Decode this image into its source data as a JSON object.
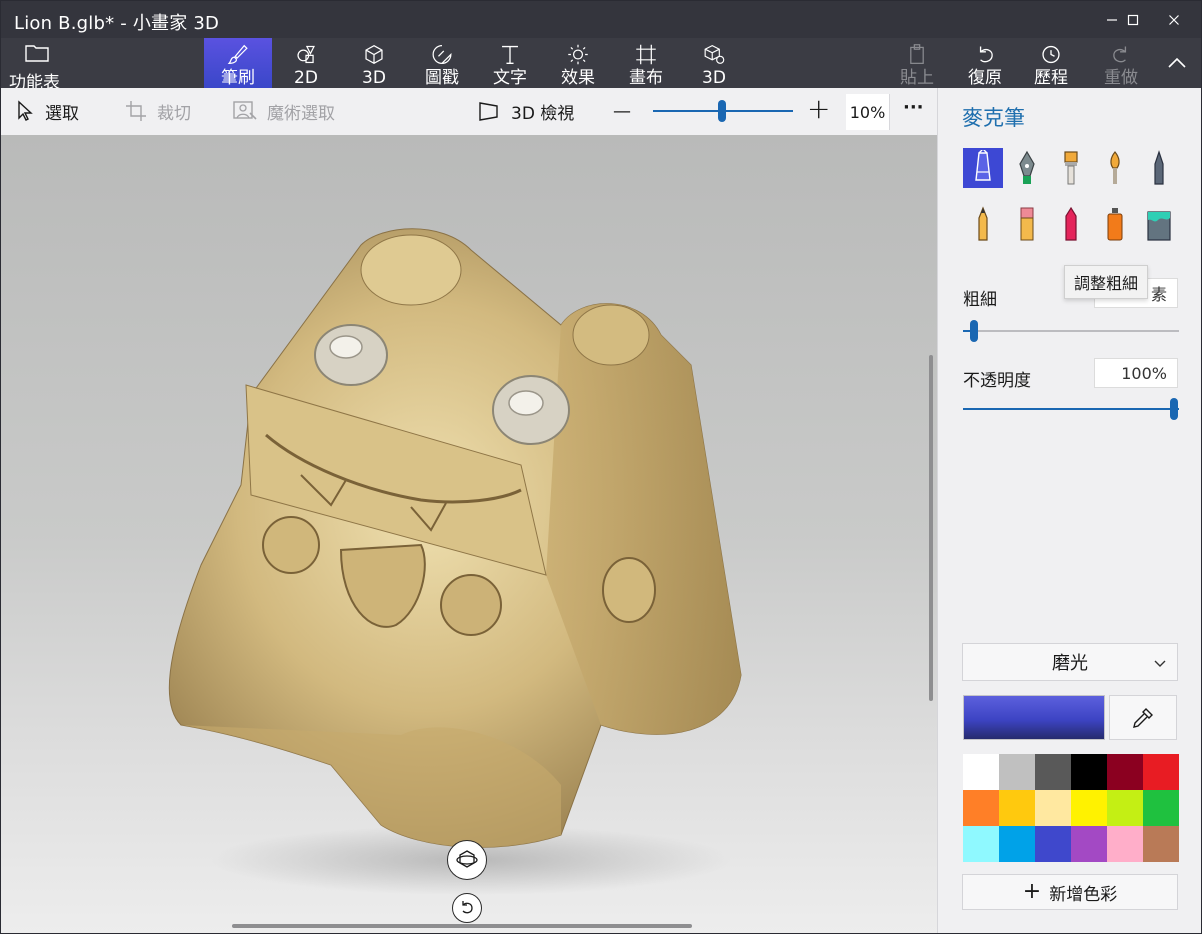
{
  "window": {
    "title": "Lion B.glb* - 小畫家 3D",
    "controls": {
      "minimize": "—",
      "maximize": "☐",
      "close": "✕"
    }
  },
  "ribbon": {
    "menu_label": "功能表",
    "tabs": [
      {
        "label": "筆刷",
        "icon": "brush-icon",
        "active": true
      },
      {
        "label": "2D",
        "icon": "2d-shapes-icon"
      },
      {
        "label": "3D",
        "icon": "3d-shapes-icon"
      },
      {
        "label": "圖戳",
        "icon": "sticker-icon"
      },
      {
        "label": "文字",
        "icon": "text-icon"
      },
      {
        "label": "效果",
        "icon": "effects-icon"
      },
      {
        "label": "畫布",
        "icon": "canvas-icon"
      },
      {
        "label": "3D",
        "icon": "3d-library-icon"
      }
    ],
    "actions": [
      {
        "label": "貼上",
        "icon": "paste-icon",
        "disabled": true
      },
      {
        "label": "復原",
        "icon": "undo-icon",
        "disabled": false
      },
      {
        "label": "歷程",
        "icon": "history-icon",
        "disabled": false
      },
      {
        "label": "重做",
        "icon": "redo-icon",
        "disabled": true
      }
    ],
    "collapse_glyph": "︿"
  },
  "toolbar": {
    "select": "選取",
    "crop": "裁切",
    "magic_select": "魔術選取",
    "view3d": "3D 檢視",
    "zoom_minus": "—",
    "zoom_plus": "+",
    "zoom_value": "10%",
    "more": "···"
  },
  "panel": {
    "title": "麥克筆",
    "brushes": [
      "marker-icon",
      "calligraphy-pen-icon",
      "oil-brush-icon",
      "watercolor-icon",
      "pixel-pen-icon",
      "pencil-icon",
      "eraser-icon",
      "crayon-icon",
      "spray-can-icon",
      "fill-bucket-icon"
    ],
    "selected_brush": "marker-icon",
    "tooltip": "調整粗細",
    "thickness_label": "粗細",
    "thickness_value_partial": "素",
    "opacity_label": "不透明度",
    "opacity_value": "100%",
    "material": "磨光",
    "current_color": "#3d44c4",
    "palette": [
      "#ffffff",
      "#c0c0c0",
      "#595959",
      "#000000",
      "#8b0020",
      "#e81c23",
      "#ff7f27",
      "#ffc90e",
      "#ffe8a0",
      "#fff200",
      "#c4ef14",
      "#1fc13f",
      "#8ff9ff",
      "#00a2e8",
      "#3f48cc",
      "#a349c4",
      "#ffaec9",
      "#b97a57"
    ],
    "add_color": "新增色彩"
  },
  "canvas": {
    "rotate_icon": "orbit-icon",
    "reset_icon": "reset-view-icon"
  }
}
